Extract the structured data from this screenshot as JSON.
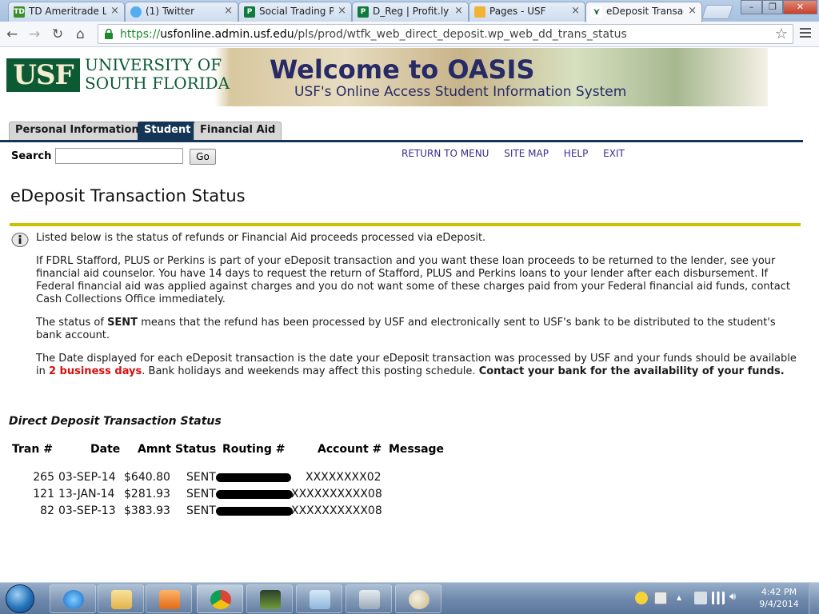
{
  "browser": {
    "tabs": [
      {
        "title": "TD Ameritrade Lo",
        "favicon": "TD"
      },
      {
        "title": "(1) Twitter",
        "favicon": "twitter-bird"
      },
      {
        "title": "Social Trading Pl",
        "favicon": "P"
      },
      {
        "title": "D_Reg | Profit.ly",
        "favicon": "P"
      },
      {
        "title": "Pages - USF",
        "favicon": "grid"
      },
      {
        "title": "eDeposit Transac",
        "favicon": "bull"
      }
    ],
    "url": {
      "scheme": "https://",
      "host": "usfonline.admin.usf.edu",
      "path": "/pls/prod/wtfk_web_direct_deposit.wp_web_dd_trans_status"
    }
  },
  "banner": {
    "logo_text": "USF",
    "university_line1": "UNIVERSITY OF",
    "university_line2": "SOUTH FLORIDA",
    "title": "Welcome to OASIS",
    "subtitle": "USF's Online Access Student Information System"
  },
  "nav_tabs": [
    "Personal Information",
    "Student",
    "Financial Aid"
  ],
  "search": {
    "label": "Search",
    "go": "Go"
  },
  "top_links": [
    "RETURN TO MENU",
    "SITE MAP",
    "HELP",
    "EXIT"
  ],
  "page_title": "eDeposit Transaction Status",
  "info": {
    "p1": "Listed below is the status of refunds or Financial Aid proceeds processed via eDeposit.",
    "p2": "If FDRL Stafford, PLUS or Perkins is part of your eDeposit transaction and you want these loan proceeds to be returned to the lender, see your financial aid counselor. You have 14 days to request the return of Stafford, PLUS and Perkins loans to your lender after each disbursement. If Federal financial aid was applied against charges and you do not want some of these charges paid from your Federal financial aid funds, contact Cash Collections Office immediately.",
    "p3_pre": "The status of ",
    "p3_bold": "SENT",
    "p3_post": " means that the refund has been processed by USF and electronically sent to USF's bank to be distributed to the student's bank account.",
    "p4_pre": "The Date displayed for each eDeposit transaction is the date your eDeposit transaction was processed by USF and your funds should be available in ",
    "p4_red": "2 business days",
    "p4_mid": ". Bank holidays and weekends may affect this posting schedule. ",
    "p4_bold": "Contact your bank for the availability of your funds."
  },
  "dd_heading": "Direct Deposit Transaction Status",
  "table": {
    "headers": [
      "Tran #",
      "Date",
      "Amnt",
      "Status",
      "Routing #",
      "Account #",
      "Message"
    ],
    "rows": [
      {
        "tran": "265",
        "date": "03-SEP-14",
        "amount": "$640.80",
        "status": "SENT",
        "account": "XXXXXXXX02"
      },
      {
        "tran": "121",
        "date": "13-JAN-14",
        "amount": "$281.93",
        "status": "SENT",
        "account": "XXXXXXXXXX08"
      },
      {
        "tran": "82",
        "date": "03-SEP-13",
        "amount": "$383.93",
        "status": "SENT",
        "account": "XXXXXXXXXX08"
      }
    ]
  },
  "taskbar": {
    "clock_time": "4:42 PM",
    "clock_date": "9/4/2014",
    "apps": [
      "internet-explorer-icon",
      "file-explorer-icon",
      "media-player-icon",
      "chrome-icon",
      "app-icon",
      "document-icon",
      "calculator-icon",
      "paint-icon"
    ]
  },
  "colors": {
    "usf_green": "#0c5a34",
    "oasis_navy": "#153556",
    "rule_yellow": "#c8c200",
    "link_purple": "#3d2b8f",
    "alert_red": "#d41111"
  }
}
